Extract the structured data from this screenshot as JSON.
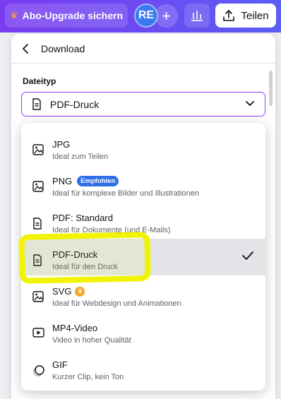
{
  "topbar": {
    "upgrade_label": "Abo-Upgrade sichern",
    "avatar_initials": "RE",
    "add_label": "+",
    "share_label": "Teilen"
  },
  "panel": {
    "title": "Download",
    "filetype_label": "Dateityp",
    "selected_value": "PDF-Druck"
  },
  "options": [
    {
      "title": "JPG",
      "desc": "Ideal zum Teilen",
      "icon": "image-icon"
    },
    {
      "title": "PNG",
      "badge": "Empfohlen",
      "desc": "Ideal für komplexe Bilder und Illustrationen",
      "icon": "image-icon"
    },
    {
      "title": "PDF: Standard",
      "desc": "Ideal für Dokumente (und E-Mails)",
      "icon": "document-icon"
    },
    {
      "title": "PDF-Druck",
      "desc": "Ideal für den Druck",
      "icon": "document-icon",
      "selected": true
    },
    {
      "title": "SVG",
      "desc": "Ideal für Webdesign und Animationen",
      "icon": "image-icon",
      "pro": true
    },
    {
      "title": "MP4-Video",
      "desc": "Video in hoher Qualität",
      "icon": "video-icon"
    },
    {
      "title": "GIF",
      "desc": "Kurzer Clip, kein Ton",
      "icon": "gif-icon"
    }
  ],
  "colors": {
    "accent": "#8b3dff",
    "topbar_start": "#7a3cf0",
    "topbar_end": "#5b5ff2",
    "highlight": "#f1f400",
    "badge": "#2d6fe6",
    "crown": "#f5a623"
  }
}
